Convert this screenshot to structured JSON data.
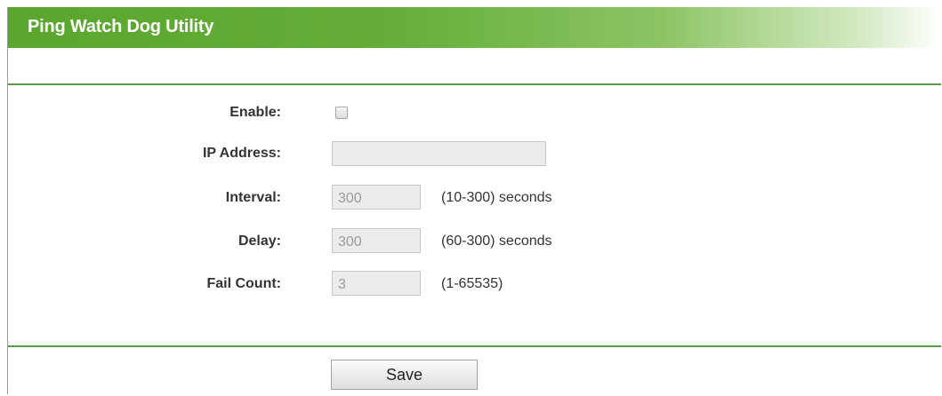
{
  "header": {
    "title": "Ping Watch Dog Utility"
  },
  "form": {
    "enable": {
      "label": "Enable:",
      "checked": false
    },
    "ip_address": {
      "label": "IP Address:",
      "value": ""
    },
    "interval": {
      "label": "Interval:",
      "value": "300",
      "hint": "(10-300) seconds"
    },
    "delay": {
      "label": "Delay:",
      "value": "300",
      "hint": "(60-300) seconds"
    },
    "fail_count": {
      "label": "Fail Count:",
      "value": "3",
      "hint": "(1-65535)"
    }
  },
  "actions": {
    "save_label": "Save"
  },
  "colors": {
    "title_bar_green": "#5aa62e",
    "rule_green": "#5a9a48",
    "field_bg": "#ececec"
  }
}
